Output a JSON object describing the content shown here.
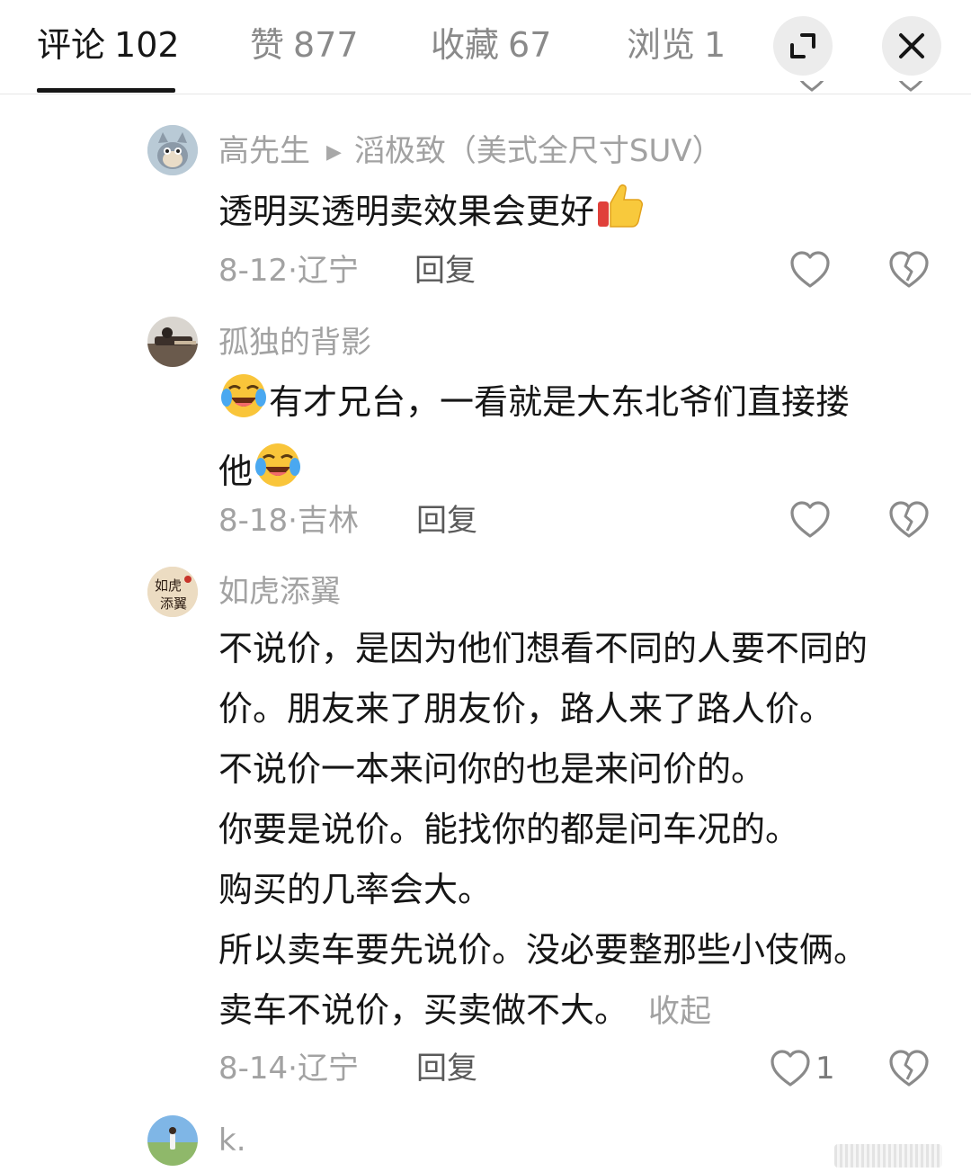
{
  "tabs": [
    {
      "label": "评论",
      "count": "102",
      "active": true
    },
    {
      "label": "赞",
      "count": "877",
      "active": false
    },
    {
      "label": "收藏",
      "count": "67",
      "active": false
    },
    {
      "label": "浏览",
      "count": "1",
      "active": false
    }
  ],
  "comments": [
    {
      "username": "高先生",
      "reply_to": "滔极致（美式全尺寸SUV）",
      "lines": [
        "透明买透明卖效果会更好"
      ],
      "emoji": "thumbs-up",
      "date": "8-12",
      "location": "辽宁",
      "reply_label": "回复",
      "likes": ""
    },
    {
      "username": "孤独的背影",
      "lines": [
        "有才兄台，一看就是大东北爷们直接搂",
        "他"
      ],
      "emoji": "laughing-crying",
      "date": "8-18",
      "location": "吉林",
      "reply_label": "回复",
      "likes": ""
    },
    {
      "username": "如虎添翼",
      "lines": [
        "不说价，是因为他们想看不同的人要不同的",
        "价。朋友来了朋友价，路人来了路人价。",
        "不说价一本来问你的也是来问价的。",
        "你要是说价。能找你的都是问车况的。",
        "购买的几率会大。",
        "所以卖车要先说价。没必要整那些小伎俩。",
        "卖车不说价，买卖做不大。"
      ],
      "collapse_label": "收起",
      "date": "8-14",
      "location": "辽宁",
      "reply_label": "回复",
      "likes": "1",
      "avatar_text": "如虎添翼"
    },
    {
      "username": "k."
    }
  ],
  "meta_separator": "·",
  "colors": {
    "text": "#161616",
    "muted": "#a2a2a2",
    "background": "#ffffff"
  }
}
